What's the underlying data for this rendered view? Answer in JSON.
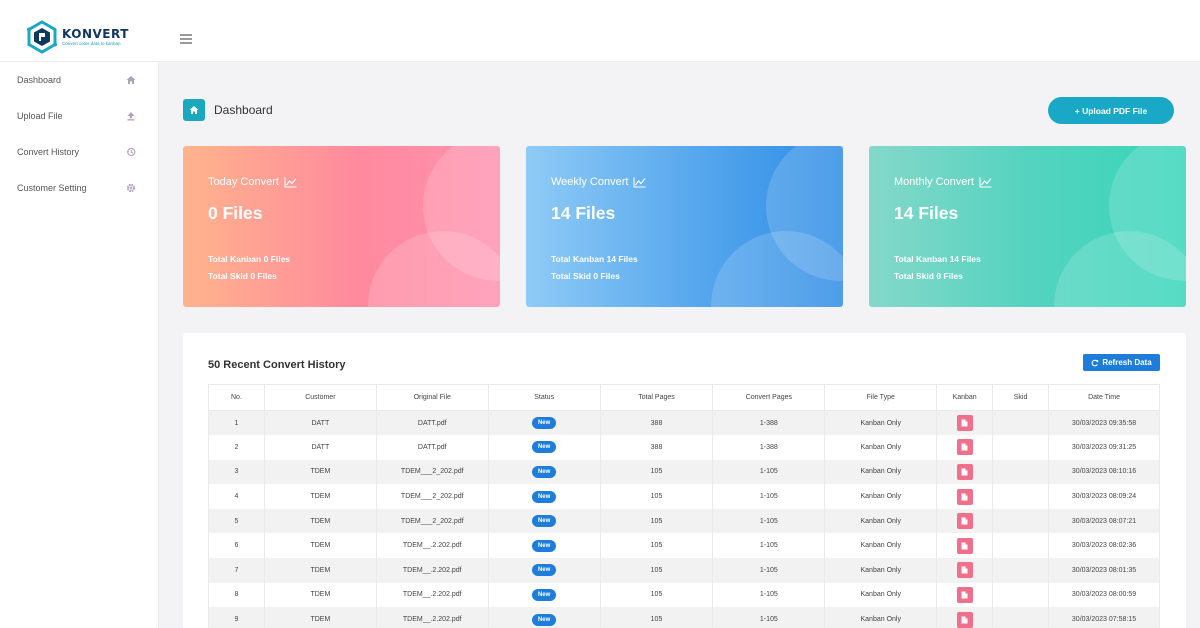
{
  "brand": {
    "name": "KONVERT",
    "tagline": "Convert order data to kanban",
    "primary_color": "#19a9c6"
  },
  "sidebar": {
    "items": [
      {
        "label": "Dashboard",
        "icon": "home-icon"
      },
      {
        "label": "Upload File",
        "icon": "upload-icon"
      },
      {
        "label": "Convert History",
        "icon": "history-icon"
      },
      {
        "label": "Customer Setting",
        "icon": "gear-icon"
      }
    ]
  },
  "header": {
    "title": "Dashboard",
    "upload_label": "+ Upload PDF File"
  },
  "cards": [
    {
      "title": "Today Convert",
      "value": "0 Files",
      "kanban": "Total Kanban 0 Files",
      "skid": "Total Skid 0 Files",
      "icon": "chart-line-icon"
    },
    {
      "title": "Weekly Convert",
      "value": "14 Files",
      "kanban": "Total Kanban 14 Files",
      "skid": "Total Skid 0 Files",
      "icon": "chart-line-icon"
    },
    {
      "title": "Monthly Convert",
      "value": "14 Files",
      "kanban": "Total Kanban 14 Files",
      "skid": "Total Skid 0 Files",
      "icon": "chart-line-icon"
    }
  ],
  "history": {
    "title": "50 Recent Convert History",
    "refresh_label": "Refresh Data",
    "columns": [
      "No.",
      "Customer",
      "Original File",
      "Status",
      "Total Pages",
      "Convert Pages",
      "File Type",
      "Kanban",
      "Skid",
      "Date Time"
    ],
    "rows": [
      {
        "no": "1",
        "customer": "DATT",
        "file": "DATT.pdf",
        "status": "New",
        "total": "388",
        "convert": "1-388",
        "type": "Kanban Only",
        "skid": "",
        "datetime": "30/03/2023 09:35:58"
      },
      {
        "no": "2",
        "customer": "DATT",
        "file": "DATT.pdf",
        "status": "New",
        "total": "388",
        "convert": "1-388",
        "type": "Kanban Only",
        "skid": "",
        "datetime": "30/03/2023 09:31:25"
      },
      {
        "no": "3",
        "customer": "TDEM",
        "file": "TDEM___2_202.pdf",
        "status": "New",
        "total": "105",
        "convert": "1-105",
        "type": "Kanban Only",
        "skid": "",
        "datetime": "30/03/2023 08:10:16"
      },
      {
        "no": "4",
        "customer": "TDEM",
        "file": "TDEM___2_202.pdf",
        "status": "New",
        "total": "105",
        "convert": "1-105",
        "type": "Kanban Only",
        "skid": "",
        "datetime": "30/03/2023 08:09:24"
      },
      {
        "no": "5",
        "customer": "TDEM",
        "file": "TDEM___2_202.pdf",
        "status": "New",
        "total": "105",
        "convert": "1-105",
        "type": "Kanban Only",
        "skid": "",
        "datetime": "30/03/2023 08:07:21"
      },
      {
        "no": "6",
        "customer": "TDEM",
        "file": "TDEM__.2.202.pdf",
        "status": "New",
        "total": "105",
        "convert": "1-105",
        "type": "Kanban Only",
        "skid": "",
        "datetime": "30/03/2023 08:02:36"
      },
      {
        "no": "7",
        "customer": "TDEM",
        "file": "TDEM__.2.202.pdf",
        "status": "New",
        "total": "105",
        "convert": "1-105",
        "type": "Kanban Only",
        "skid": "",
        "datetime": "30/03/2023 08:01:35"
      },
      {
        "no": "8",
        "customer": "TDEM",
        "file": "TDEM__.2.202.pdf",
        "status": "New",
        "total": "105",
        "convert": "1-105",
        "type": "Kanban Only",
        "skid": "",
        "datetime": "30/03/2023 08:00:59"
      },
      {
        "no": "9",
        "customer": "TDEM",
        "file": "TDEM__.2.202.pdf",
        "status": "New",
        "total": "105",
        "convert": "1-105",
        "type": "Kanban Only",
        "skid": "",
        "datetime": "30/03/2023 07:58:15"
      }
    ]
  }
}
